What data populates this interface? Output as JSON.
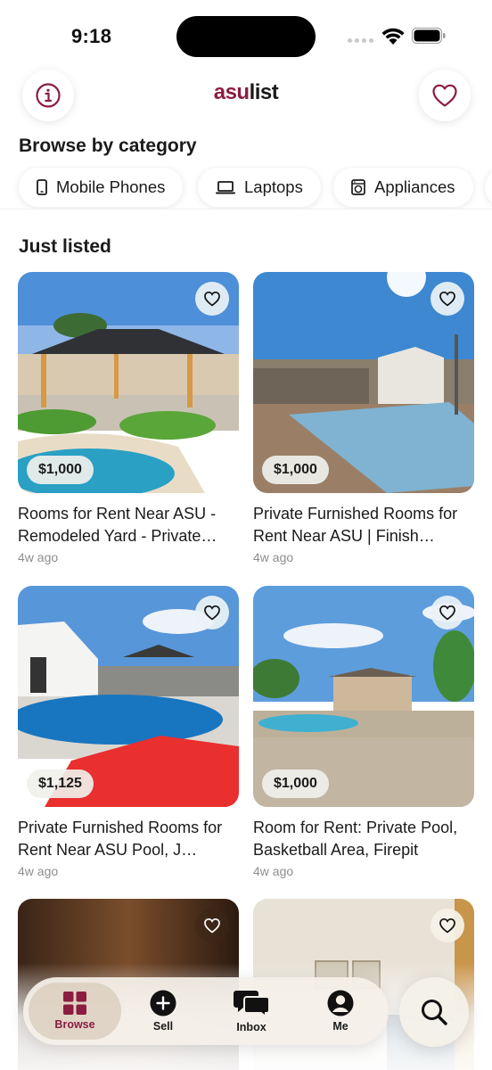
{
  "status_bar": {
    "time": "9:18"
  },
  "header": {
    "logo_part1": "asu",
    "logo_part2": "list"
  },
  "categories": {
    "title": "Browse by category",
    "items": [
      {
        "label": "Mobile Phones",
        "icon": "mobile-phone-icon"
      },
      {
        "label": "Laptops",
        "icon": "laptop-icon"
      },
      {
        "label": "Appliances",
        "icon": "appliance-icon"
      }
    ]
  },
  "listings": {
    "title": "Just listed",
    "items": [
      {
        "price": "$1,000",
        "title": "Rooms for Rent Near ASU - Remodeled Yard - Private…",
        "ago": "4w ago"
      },
      {
        "price": "$1,000",
        "title": "Private Furnished Rooms for Rent Near ASU | Finish…",
        "ago": "4w ago"
      },
      {
        "price": "$1,125",
        "title": "Private Furnished Rooms for Rent Near ASU Pool, J…",
        "ago": "4w ago"
      },
      {
        "price": "$1,000",
        "title": "Room for Rent: Private Pool, Basketball Area, Firepit",
        "ago": "4w ago"
      }
    ]
  },
  "tabbar": {
    "items": [
      {
        "label": "Browse",
        "icon": "grid-icon",
        "active": true
      },
      {
        "label": "Sell",
        "icon": "plus-circle-icon"
      },
      {
        "label": "Inbox",
        "icon": "chat-bubbles-icon"
      },
      {
        "label": "Me",
        "icon": "person-icon"
      }
    ]
  },
  "colors": {
    "brand": "#8c1d40",
    "text": "#1a1a1a",
    "muted": "#8e8e8e"
  }
}
